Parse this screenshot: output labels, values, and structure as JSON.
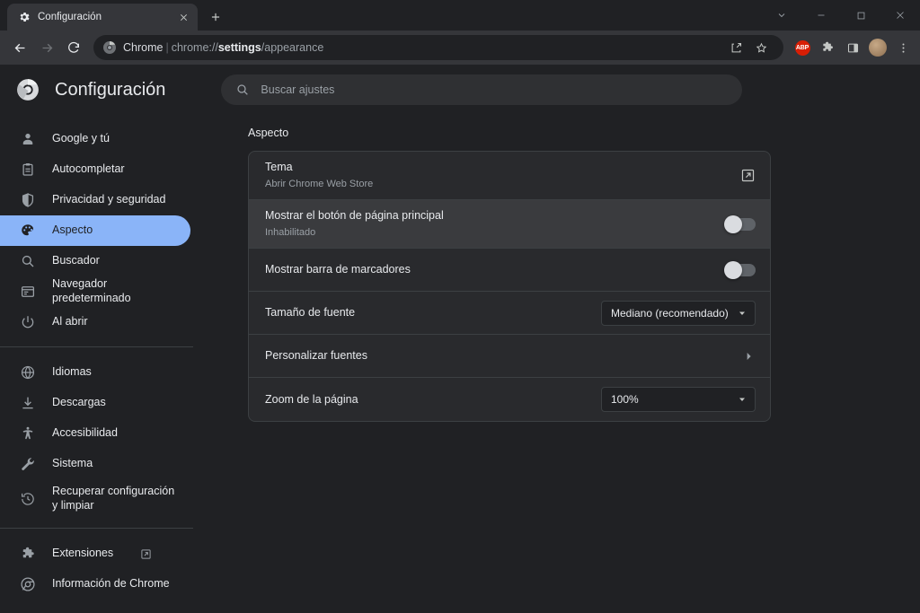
{
  "window": {
    "controls": [
      {
        "name": "tab-search-button",
        "icon": "chevron-down-icon"
      },
      {
        "name": "minimize-button",
        "icon": "minimize-icon"
      },
      {
        "name": "maximize-button",
        "icon": "maximize-icon"
      },
      {
        "name": "close-button",
        "icon": "close-icon"
      }
    ]
  },
  "tab": {
    "title": "Configuración",
    "favicon": "gear-icon",
    "close_label": "✕",
    "newtab_label": "+"
  },
  "toolbar": {
    "back_label": "←",
    "forward_label": "→",
    "reload_label": "⟳",
    "omnibox": {
      "brand": "Chrome",
      "separator": "|",
      "scheme": "chrome://",
      "host": "settings",
      "path": "/appearance",
      "full_url": "chrome://settings/appearance"
    },
    "actions": [
      {
        "name": "share-icon",
        "label": "share"
      },
      {
        "name": "bookmark-star-icon",
        "label": "star"
      },
      {
        "name": "adblock-plus-icon",
        "label": "ABP"
      },
      {
        "name": "extensions-puzzle-icon",
        "label": "extensions"
      },
      {
        "name": "side-panel-icon",
        "label": "side panel"
      },
      {
        "name": "avatar",
        "label": "profile"
      },
      {
        "name": "more-menu-icon",
        "label": "⋮"
      }
    ]
  },
  "settings": {
    "title": "Configuración",
    "logo": "chrome-logo-icon",
    "search": {
      "placeholder": "Buscar ajustes",
      "value": "",
      "icon": "search-icon"
    }
  },
  "sidebar": {
    "groups": [
      {
        "items": [
          {
            "label": "Google y tú",
            "icon": "person-icon",
            "selected": false
          },
          {
            "label": "Autocompletar",
            "icon": "clipboard-icon",
            "selected": false
          },
          {
            "label": "Privacidad y seguridad",
            "icon": "shield-icon",
            "selected": false
          },
          {
            "label": "Aspecto",
            "icon": "palette-icon",
            "selected": true
          },
          {
            "label": "Buscador",
            "icon": "search-icon",
            "selected": false
          },
          {
            "label": "Navegador predeterminado",
            "icon": "browser-window-icon",
            "selected": false
          },
          {
            "label": "Al abrir",
            "icon": "power-icon",
            "selected": false
          }
        ]
      },
      {
        "items": [
          {
            "label": "Idiomas",
            "icon": "globe-icon",
            "selected": false
          },
          {
            "label": "Descargas",
            "icon": "download-icon",
            "selected": false
          },
          {
            "label": "Accesibilidad",
            "icon": "accessibility-icon",
            "selected": false
          },
          {
            "label": "Sistema",
            "icon": "wrench-icon",
            "selected": false
          },
          {
            "label": "Recuperar configuración y limpiar",
            "icon": "restore-clock-icon",
            "selected": false
          }
        ]
      },
      {
        "items": [
          {
            "label": "Extensiones",
            "icon": "puzzle-icon",
            "external": true,
            "selected": false
          },
          {
            "label": "Información de Chrome",
            "icon": "chrome-logo-icon",
            "selected": false
          }
        ]
      }
    ]
  },
  "main": {
    "section_title": "Aspecto",
    "rows": {
      "theme": {
        "title": "Tema",
        "subtitle": "Abrir Chrome Web Store",
        "trailing_icon": "external-link-icon"
      },
      "home_button": {
        "title": "Mostrar el botón de página principal",
        "subtitle": "Inhabilitado",
        "toggle_state": "off",
        "hovered": true
      },
      "bookmarks_bar": {
        "title": "Mostrar barra de marcadores",
        "toggle_state": "off"
      },
      "font_size": {
        "title": "Tamaño de fuente",
        "value": "Mediano (recomendado)"
      },
      "customize_fonts": {
        "title": "Personalizar fuentes",
        "trailing_icon": "chevron-right-icon"
      },
      "page_zoom": {
        "title": "Zoom de la página",
        "value": "100%"
      }
    }
  },
  "colors": {
    "background": "#202124",
    "surface": "#292a2d",
    "tab_active": "#35363a",
    "accent": "#8ab4f8",
    "text_primary": "#e8eaed",
    "text_secondary": "#9aa0a6",
    "divider": "#3c4043",
    "adblock_red": "#d81e05"
  }
}
